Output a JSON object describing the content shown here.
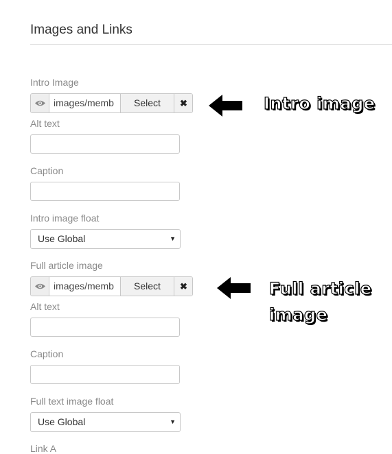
{
  "section": {
    "title": "Images and Links"
  },
  "intro": {
    "label": "Intro Image",
    "path": "images/memb",
    "select_label": "Select",
    "clear_label": "✖",
    "alt_label": "Alt text",
    "alt_value": "",
    "caption_label": "Caption",
    "caption_value": "",
    "float_label": "Intro image float",
    "float_value": "Use Global"
  },
  "full": {
    "label": "Full article image",
    "path": "images/memb",
    "select_label": "Select",
    "clear_label": "✖",
    "alt_label": "Alt text",
    "alt_value": "",
    "caption_label": "Caption",
    "caption_value": "",
    "float_label": "Full text image float",
    "float_value": "Use Global"
  },
  "link_a": {
    "label": "Link A"
  },
  "annotations": {
    "intro_note": "Intro image",
    "full_note_line1": "Full article",
    "full_note_line2": "image"
  },
  "icons": {
    "preview": "eye-icon",
    "clear": "close-icon",
    "caret": "caret-down-icon",
    "arrow": "arrow-left-icon"
  }
}
